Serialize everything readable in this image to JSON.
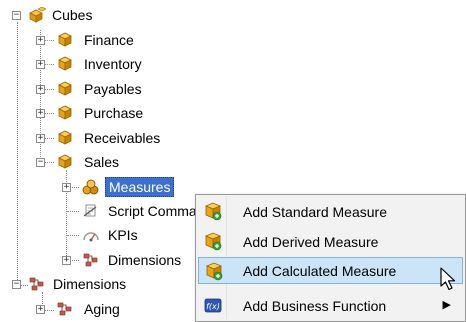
{
  "tree": {
    "root": "Cubes",
    "cubes": [
      "Finance",
      "Inventory",
      "Payables",
      "Purchase",
      "Receivables",
      "Sales"
    ],
    "sales_children": [
      "Measures",
      "Script Comma",
      "KPIs",
      "Dimensions"
    ],
    "dimensions_root": "Dimensions",
    "dimension_children": [
      "Aging"
    ]
  },
  "context_menu": {
    "items": [
      {
        "label": "Add Standard Measure",
        "icon": "standard-measure-icon"
      },
      {
        "label": "Add Derived Measure",
        "icon": "derived-measure-icon"
      },
      {
        "label": "Add Calculated Measure",
        "icon": "calculated-measure-icon",
        "highlighted": true
      },
      {
        "label": "Add Business Function",
        "icon": "business-function-icon",
        "has_submenu": true
      }
    ]
  },
  "colors": {
    "selection": "#3b6fd0",
    "menu_highlight": "#cce4f7",
    "cube": "#e8a416"
  }
}
